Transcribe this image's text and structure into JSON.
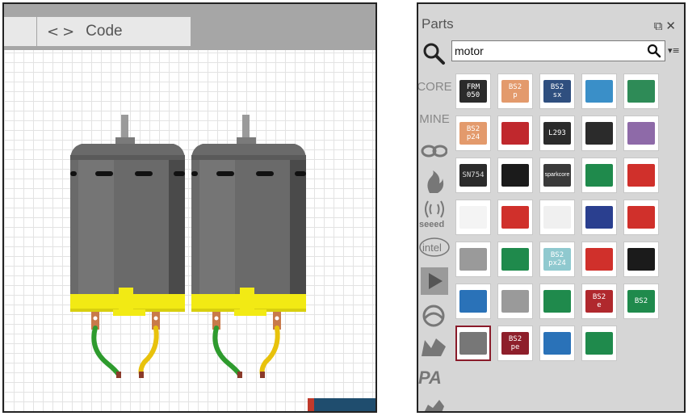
{
  "editor": {
    "tab_code_label": "Code",
    "code_icon": "<>"
  },
  "parts_panel": {
    "title": "Parts",
    "search": {
      "value": "motor"
    },
    "bins": {
      "core_label": "CORE",
      "mine_label": "MINE"
    },
    "items": [
      {
        "label": "FRM\n050",
        "bg": "#2b2b2b",
        "fg": "#ffffff"
      },
      {
        "label": "BS2\np",
        "bg": "#e39a6c",
        "fg": "#ffffff"
      },
      {
        "label": "BS2\nsx",
        "bg": "#2f4f7f",
        "fg": "#ffffff"
      },
      {
        "label": "",
        "bg": "#3a8fc8",
        "fg": "#ffffff"
      },
      {
        "label": "",
        "bg": "#2e8b57",
        "fg": "#ffffff"
      },
      {
        "label": "BS2\np24",
        "bg": "#e39a6c",
        "fg": "#ffffff"
      },
      {
        "label": "",
        "bg": "#c0282d",
        "fg": "#ffffff"
      },
      {
        "label": "L293",
        "bg": "#2b2b2b",
        "fg": "#ffffff"
      },
      {
        "label": "",
        "bg": "#2b2b2b",
        "fg": "#ffffff"
      },
      {
        "label": "",
        "bg": "#8e6aa8",
        "fg": "#ffffff"
      },
      {
        "label": "SN754",
        "bg": "#2b2b2b",
        "fg": "#dddddd"
      },
      {
        "label": "",
        "bg": "#1b1b1b",
        "fg": "#ffffff"
      },
      {
        "label": "sparkcore",
        "bg": "#3a3a3a",
        "fg": "#ffffff"
      },
      {
        "label": "",
        "bg": "#1f8a4c",
        "fg": "#ffffff"
      },
      {
        "label": "",
        "bg": "#d0302b",
        "fg": "#ffffff"
      },
      {
        "label": "",
        "bg": "#f4f4f4",
        "fg": "#333333"
      },
      {
        "label": "",
        "bg": "#d0302b",
        "fg": "#ffffff"
      },
      {
        "label": "",
        "bg": "#f0f0f0",
        "fg": "#333333"
      },
      {
        "label": "",
        "bg": "#2a3f8f",
        "fg": "#ffffff"
      },
      {
        "label": "",
        "bg": "#d0302b",
        "fg": "#ffffff"
      },
      {
        "label": "",
        "bg": "#9a9a9a",
        "fg": "#ffffff"
      },
      {
        "label": "",
        "bg": "#1f8a4c",
        "fg": "#ffffff"
      },
      {
        "label": "BS2\npx24",
        "bg": "#8fc9cf",
        "fg": "#ffffff"
      },
      {
        "label": "",
        "bg": "#d0302b",
        "fg": "#ffffff"
      },
      {
        "label": "",
        "bg": "#1b1b1b",
        "fg": "#ffffff"
      },
      {
        "label": "",
        "bg": "#2a72b8",
        "fg": "#ffffff"
      },
      {
        "label": "",
        "bg": "#9a9a9a",
        "fg": "#ffffff"
      },
      {
        "label": "",
        "bg": "#1f8a4c",
        "fg": "#ffffff"
      },
      {
        "label": "BS2\ne",
        "bg": "#b0282d",
        "fg": "#ffffff"
      },
      {
        "label": "BS2",
        "bg": "#1f8a4c",
        "fg": "#ffffff"
      },
      {
        "label": "",
        "bg": "#777777",
        "fg": "#ffffff",
        "selected": true
      },
      {
        "label": "BS2\npe",
        "bg": "#8e1f2b",
        "fg": "#ffffff"
      },
      {
        "label": "",
        "bg": "#2a72b8",
        "fg": "#ffffff"
      },
      {
        "label": "",
        "bg": "#1f8a4c",
        "fg": "#ffffff"
      }
    ]
  },
  "colors": {
    "motor_body": "#6a6a6a",
    "motor_band": "#f2ea14",
    "wire_green": "#2e9b2e",
    "wire_yellow": "#e8c20c"
  }
}
